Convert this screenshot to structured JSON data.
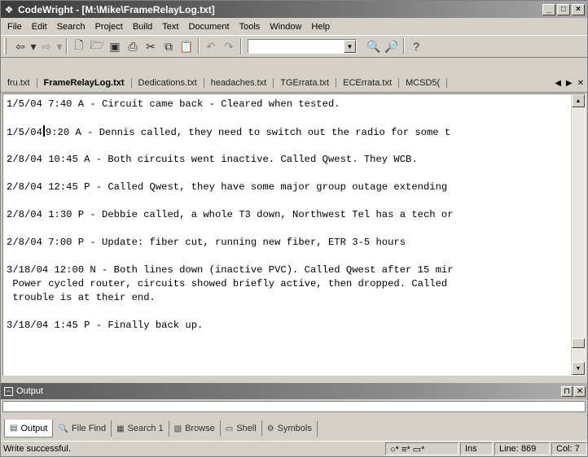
{
  "window": {
    "title": "CodeWright - [M:\\Mike\\FrameRelayLog.txt]",
    "app_icon": "codewright-logo",
    "controls": [
      "_",
      "□",
      "×"
    ]
  },
  "menu": [
    "File",
    "Edit",
    "Search",
    "Project",
    "Build",
    "Text",
    "Document",
    "Tools",
    "Window",
    "Help"
  ],
  "toolbar": {
    "buttons": [
      {
        "name": "back-icon",
        "glyph": "⇦",
        "dim": false
      },
      {
        "name": "dropdown-icon",
        "glyph": "▾",
        "dim": false
      },
      {
        "name": "forward-icon",
        "glyph": "⇨",
        "dim": true
      },
      {
        "name": "dropdown-icon",
        "glyph": "▾",
        "dim": true
      },
      {
        "name": "new-file-icon",
        "glyph": "🗋",
        "dim": false
      },
      {
        "name": "open-folder-icon",
        "glyph": "🗁",
        "dim": false
      },
      {
        "name": "save-icon",
        "glyph": "▣",
        "dim": false
      },
      {
        "name": "print-icon",
        "glyph": "⎙",
        "dim": false
      },
      {
        "name": "cut-icon",
        "glyph": "✂",
        "dim": false
      },
      {
        "name": "copy-icon",
        "glyph": "⧉",
        "dim": false
      },
      {
        "name": "paste-icon",
        "glyph": "📋",
        "dim": false
      },
      {
        "name": "undo-icon",
        "glyph": "↶",
        "dim": true
      },
      {
        "name": "redo-icon",
        "glyph": "↷",
        "dim": true
      }
    ],
    "search_value": "",
    "right_buttons": [
      {
        "name": "find-icon",
        "glyph": "🔍"
      },
      {
        "name": "find-next-icon",
        "glyph": "🔎"
      },
      {
        "name": "help-icon",
        "glyph": "?"
      }
    ]
  },
  "tabs": [
    {
      "label": "fru.txt",
      "active": false
    },
    {
      "label": "FrameRelayLog.txt",
      "active": true
    },
    {
      "label": "Dedications.txt",
      "active": false
    },
    {
      "label": "headaches.txt",
      "active": false
    },
    {
      "label": "TGErrata.txt",
      "active": false
    },
    {
      "label": "ECErrata.txt",
      "active": false
    },
    {
      "label": "MCSD5(",
      "active": false
    }
  ],
  "editor": {
    "lines": [
      "1/5/04 7:40 A - Circuit came back - Cleared when tested.",
      "",
      "1/5/04|9:20 A - Dennis called, they need to switch out the radio for some t",
      "",
      "2/8/04 10:45 A - Both circuits went inactive. Called Qwest. They WCB.",
      "",
      "2/8/04 12:45 P - Called Qwest, they have some major group outage extending",
      "",
      "2/8/04 1:30 P - Debbie called, a whole T3 down, Northwest Tel has a tech or",
      "",
      "2/8/04 7:00 P - Update: fiber cut, running new fiber, ETR 3-5 hours",
      "",
      "3/18/04 12:00 N - Both lines down (inactive PVC). Called Qwest after 15 mir",
      " Power cycled router, circuits showed briefly active, then dropped. Called",
      " trouble is at their end.",
      "",
      "3/18/04 1:45 P - Finally back up."
    ]
  },
  "output": {
    "title": "Output",
    "tabs": [
      {
        "label": "Output",
        "icon": "output-icon",
        "glyph": "▤",
        "active": true
      },
      {
        "label": "File Find",
        "icon": "file-find-icon",
        "glyph": "🔍",
        "active": false
      },
      {
        "label": "Search 1",
        "icon": "search-results-icon",
        "glyph": "▦",
        "active": false
      },
      {
        "label": "Browse",
        "icon": "browse-icon",
        "glyph": "▧",
        "active": false
      },
      {
        "label": "Shell",
        "icon": "shell-icon",
        "glyph": "▭",
        "active": false
      },
      {
        "label": "Symbols",
        "icon": "symbols-icon",
        "glyph": "⚙",
        "active": false
      }
    ]
  },
  "status": {
    "message": "Write successful.",
    "indicators": "○* ≡* ▭*",
    "mode": "Ins",
    "line": "Line: 869",
    "col": "Col: 7"
  }
}
